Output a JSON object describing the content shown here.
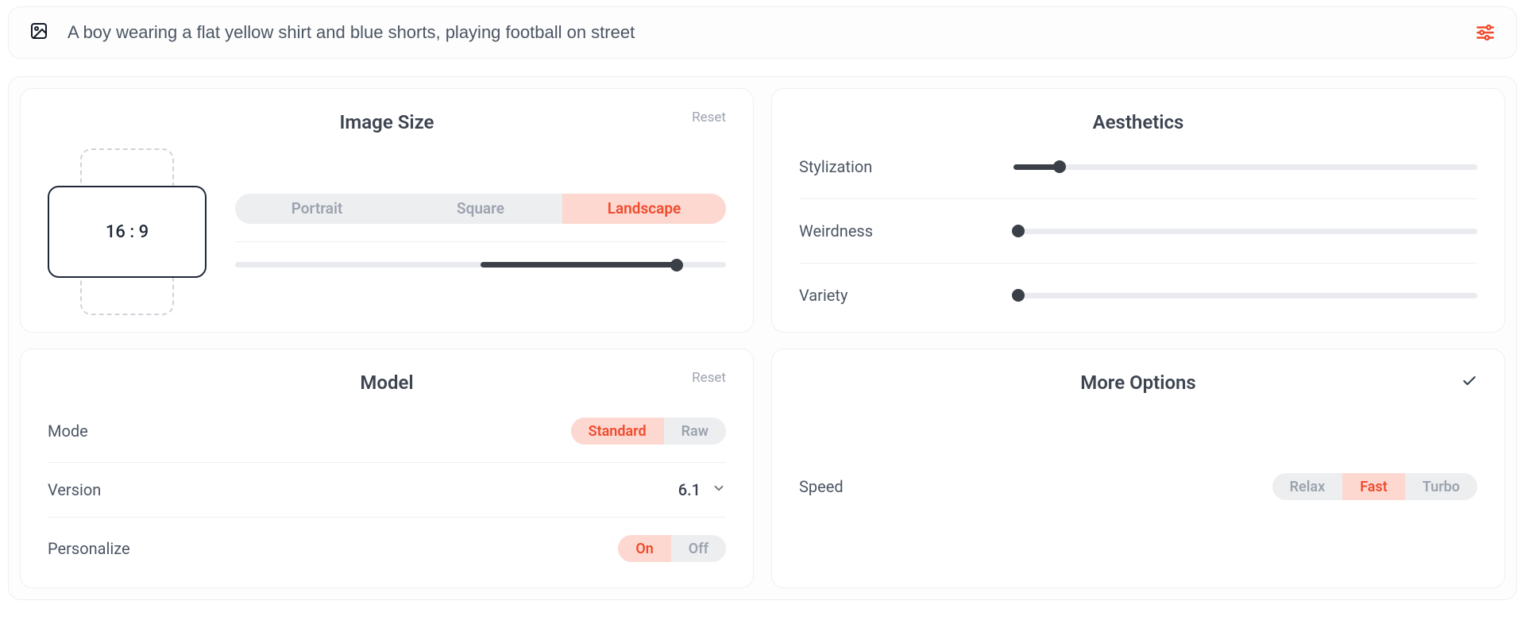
{
  "prompt": {
    "value": "A boy wearing a flat yellow shirt and blue shorts, playing football on street"
  },
  "imageSize": {
    "title": "Image Size",
    "reset": "Reset",
    "ratioLabel": "16 : 9",
    "options": [
      "Portrait",
      "Square",
      "Landscape"
    ],
    "selectedIndex": 2,
    "sliderPercent": 90,
    "fillStartPercent": 50
  },
  "aesthetics": {
    "title": "Aesthetics",
    "rows": [
      {
        "label": "Stylization",
        "percent": 10,
        "fillStart": 0
      },
      {
        "label": "Weirdness",
        "percent": 1,
        "fillStart": 0
      },
      {
        "label": "Variety",
        "percent": 1,
        "fillStart": 0
      }
    ]
  },
  "model": {
    "title": "Model",
    "reset": "Reset",
    "modeLabel": "Mode",
    "modeOptions": [
      "Standard",
      "Raw"
    ],
    "modeSelectedIndex": 0,
    "versionLabel": "Version",
    "versionValue": "6.1",
    "personalizeLabel": "Personalize",
    "personalizeOptions": [
      "On",
      "Off"
    ],
    "personalizeSelectedIndex": 0
  },
  "more": {
    "title": "More Options",
    "speedLabel": "Speed",
    "speedOptions": [
      "Relax",
      "Fast",
      "Turbo"
    ],
    "speedSelectedIndex": 1
  }
}
